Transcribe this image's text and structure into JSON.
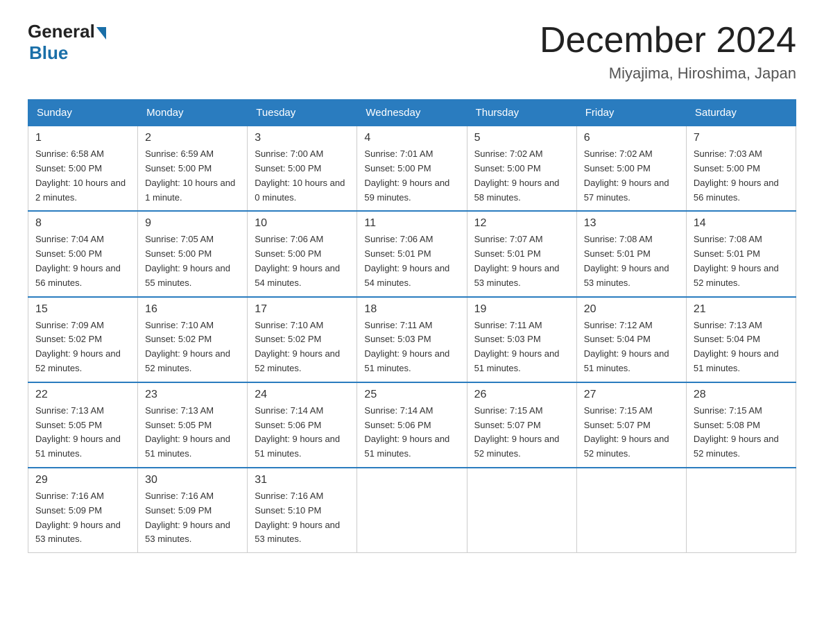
{
  "header": {
    "logo_general": "General",
    "logo_blue": "Blue",
    "month_title": "December 2024",
    "location": "Miyajima, Hiroshima, Japan"
  },
  "weekdays": [
    "Sunday",
    "Monday",
    "Tuesday",
    "Wednesday",
    "Thursday",
    "Friday",
    "Saturday"
  ],
  "weeks": [
    [
      {
        "day": "1",
        "sunrise": "6:58 AM",
        "sunset": "5:00 PM",
        "daylight": "10 hours and 2 minutes."
      },
      {
        "day": "2",
        "sunrise": "6:59 AM",
        "sunset": "5:00 PM",
        "daylight": "10 hours and 1 minute."
      },
      {
        "day": "3",
        "sunrise": "7:00 AM",
        "sunset": "5:00 PM",
        "daylight": "10 hours and 0 minutes."
      },
      {
        "day": "4",
        "sunrise": "7:01 AM",
        "sunset": "5:00 PM",
        "daylight": "9 hours and 59 minutes."
      },
      {
        "day": "5",
        "sunrise": "7:02 AM",
        "sunset": "5:00 PM",
        "daylight": "9 hours and 58 minutes."
      },
      {
        "day": "6",
        "sunrise": "7:02 AM",
        "sunset": "5:00 PM",
        "daylight": "9 hours and 57 minutes."
      },
      {
        "day": "7",
        "sunrise": "7:03 AM",
        "sunset": "5:00 PM",
        "daylight": "9 hours and 56 minutes."
      }
    ],
    [
      {
        "day": "8",
        "sunrise": "7:04 AM",
        "sunset": "5:00 PM",
        "daylight": "9 hours and 56 minutes."
      },
      {
        "day": "9",
        "sunrise": "7:05 AM",
        "sunset": "5:00 PM",
        "daylight": "9 hours and 55 minutes."
      },
      {
        "day": "10",
        "sunrise": "7:06 AM",
        "sunset": "5:00 PM",
        "daylight": "9 hours and 54 minutes."
      },
      {
        "day": "11",
        "sunrise": "7:06 AM",
        "sunset": "5:01 PM",
        "daylight": "9 hours and 54 minutes."
      },
      {
        "day": "12",
        "sunrise": "7:07 AM",
        "sunset": "5:01 PM",
        "daylight": "9 hours and 53 minutes."
      },
      {
        "day": "13",
        "sunrise": "7:08 AM",
        "sunset": "5:01 PM",
        "daylight": "9 hours and 53 minutes."
      },
      {
        "day": "14",
        "sunrise": "7:08 AM",
        "sunset": "5:01 PM",
        "daylight": "9 hours and 52 minutes."
      }
    ],
    [
      {
        "day": "15",
        "sunrise": "7:09 AM",
        "sunset": "5:02 PM",
        "daylight": "9 hours and 52 minutes."
      },
      {
        "day": "16",
        "sunrise": "7:10 AM",
        "sunset": "5:02 PM",
        "daylight": "9 hours and 52 minutes."
      },
      {
        "day": "17",
        "sunrise": "7:10 AM",
        "sunset": "5:02 PM",
        "daylight": "9 hours and 52 minutes."
      },
      {
        "day": "18",
        "sunrise": "7:11 AM",
        "sunset": "5:03 PM",
        "daylight": "9 hours and 51 minutes."
      },
      {
        "day": "19",
        "sunrise": "7:11 AM",
        "sunset": "5:03 PM",
        "daylight": "9 hours and 51 minutes."
      },
      {
        "day": "20",
        "sunrise": "7:12 AM",
        "sunset": "5:04 PM",
        "daylight": "9 hours and 51 minutes."
      },
      {
        "day": "21",
        "sunrise": "7:13 AM",
        "sunset": "5:04 PM",
        "daylight": "9 hours and 51 minutes."
      }
    ],
    [
      {
        "day": "22",
        "sunrise": "7:13 AM",
        "sunset": "5:05 PM",
        "daylight": "9 hours and 51 minutes."
      },
      {
        "day": "23",
        "sunrise": "7:13 AM",
        "sunset": "5:05 PM",
        "daylight": "9 hours and 51 minutes."
      },
      {
        "day": "24",
        "sunrise": "7:14 AM",
        "sunset": "5:06 PM",
        "daylight": "9 hours and 51 minutes."
      },
      {
        "day": "25",
        "sunrise": "7:14 AM",
        "sunset": "5:06 PM",
        "daylight": "9 hours and 51 minutes."
      },
      {
        "day": "26",
        "sunrise": "7:15 AM",
        "sunset": "5:07 PM",
        "daylight": "9 hours and 52 minutes."
      },
      {
        "day": "27",
        "sunrise": "7:15 AM",
        "sunset": "5:07 PM",
        "daylight": "9 hours and 52 minutes."
      },
      {
        "day": "28",
        "sunrise": "7:15 AM",
        "sunset": "5:08 PM",
        "daylight": "9 hours and 52 minutes."
      }
    ],
    [
      {
        "day": "29",
        "sunrise": "7:16 AM",
        "sunset": "5:09 PM",
        "daylight": "9 hours and 53 minutes."
      },
      {
        "day": "30",
        "sunrise": "7:16 AM",
        "sunset": "5:09 PM",
        "daylight": "9 hours and 53 minutes."
      },
      {
        "day": "31",
        "sunrise": "7:16 AM",
        "sunset": "5:10 PM",
        "daylight": "9 hours and 53 minutes."
      },
      null,
      null,
      null,
      null
    ]
  ]
}
